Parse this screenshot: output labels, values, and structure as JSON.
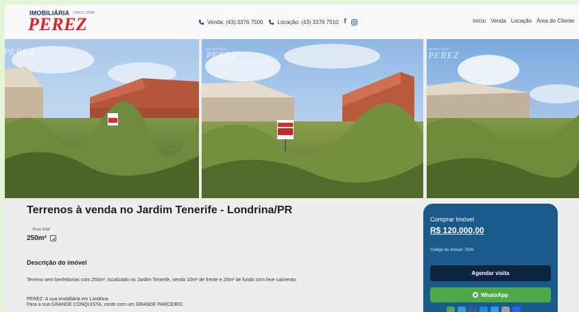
{
  "brand": {
    "top": "IMOBILIÁRIA",
    "creci": "CRECI J2898",
    "main": "PEREZ",
    "watermark": "PEREZ",
    "watermark_top": "IMOBILIÁRIA"
  },
  "contacts": {
    "venda": "Venda: (43) 3376 7500",
    "locacao": "Locação: (43) 3376 7510"
  },
  "nav": [
    "Início",
    "Venda",
    "Locação",
    "Área do Cliente"
  ],
  "property": {
    "title": "Terrenos à venda no Jardim Tenerife - Londrina/PR",
    "area_label": "Área total",
    "area_value": "250m²",
    "desc_heading": "Descrição do imóvel",
    "description": "Terreno sem benfeitorias com 250m², localizado no Jardim Tenerife, sendo 10m² de frente e 25m² de fundo com leve caimento.",
    "tagline1": "PEREZ: A sua imobiliária em Londrina",
    "tagline2": "Para a sua GRANDE CONQUISTA, conte com um GRANDE PARCEIRO."
  },
  "sign": {
    "brand": "PEREZ",
    "label": "VENDE"
  },
  "card": {
    "heading": "Comprar Imóvel",
    "price": "R$ 120.000,00",
    "code": "Código do Imóvel: 7826",
    "visit_button": "Agendar visita",
    "whatsapp_button": "WhatsApp"
  },
  "colors": {
    "accent": "#e02127",
    "card": "#1a5a8a",
    "visit": "#0e2340",
    "whatsapp": "#4ea94a"
  },
  "icons": [
    "phone-icon",
    "facebook-icon",
    "instagram-icon",
    "area-icon",
    "whatsapp-icon",
    "share-icon"
  ]
}
